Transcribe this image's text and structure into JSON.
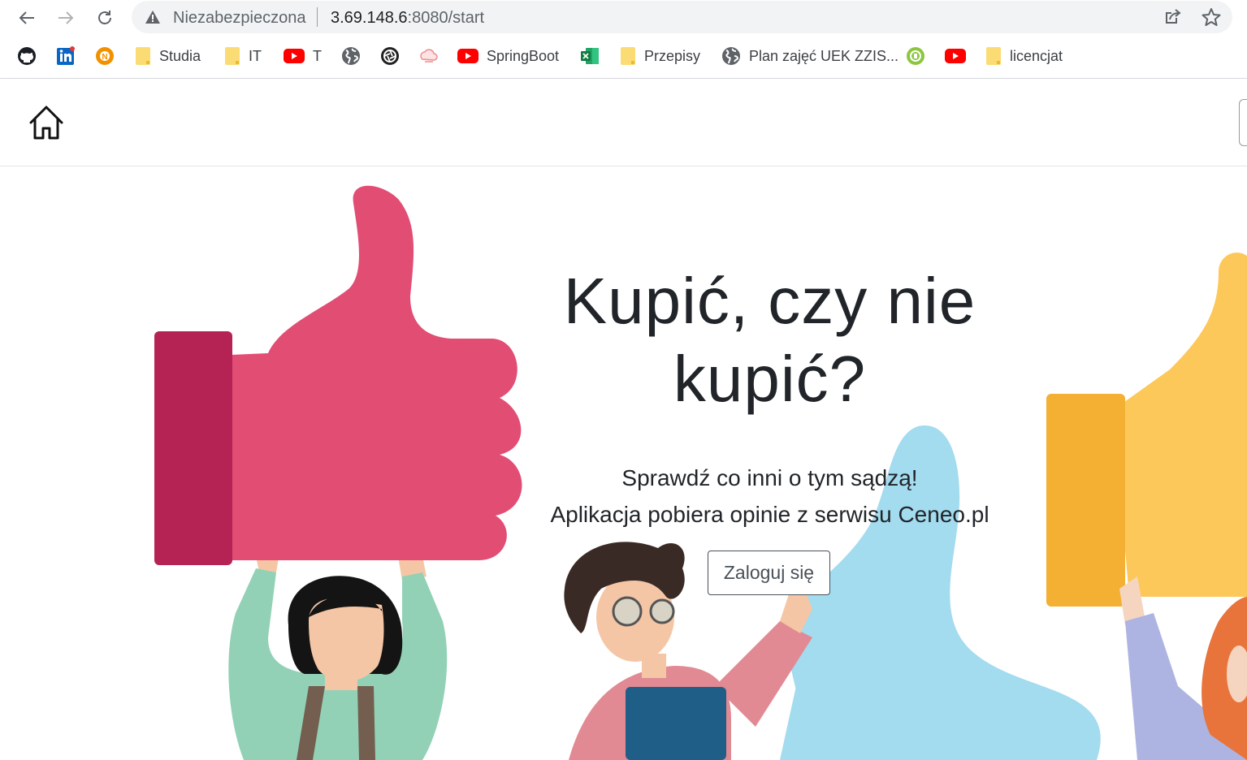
{
  "browser": {
    "security_label": "Niezabezpieczona",
    "url_host": "3.69.148.6",
    "url_rest": ":8080/start",
    "bookmarks": [
      {
        "icon": "github-icon",
        "label": ""
      },
      {
        "icon": "linkedin-icon",
        "label": ""
      },
      {
        "icon": "nn-icon",
        "label": ""
      },
      {
        "icon": "folder-icon",
        "label": "Studia"
      },
      {
        "icon": "folder-icon",
        "label": "IT"
      },
      {
        "icon": "youtube-icon",
        "label": "T"
      },
      {
        "icon": "globe-icon",
        "label": ""
      },
      {
        "icon": "aperture-icon",
        "label": ""
      },
      {
        "icon": "cloud-icon",
        "label": ""
      },
      {
        "icon": "youtube-icon",
        "label": "SpringBoot"
      },
      {
        "icon": "excel-icon",
        "label": ""
      },
      {
        "icon": "folder-icon",
        "label": "Przepisy"
      },
      {
        "icon": "globe-icon",
        "label": "Plan zajęć UEK ZZIS..."
      },
      {
        "icon": "green-badge-icon",
        "label": ""
      },
      {
        "icon": "youtube-icon",
        "label": ""
      },
      {
        "icon": "folder-icon",
        "label": "licencjat"
      }
    ]
  },
  "hero": {
    "title_line1": "Kupić, czy nie",
    "title_line2": "kupić?",
    "subtitle_line1": "Sprawdź co inni o tym sądzą!",
    "subtitle_line2": "Aplikacja pobiera opinie z serwisu Ceneo.pl",
    "login_label": "Zaloguj się"
  },
  "colors": {
    "thumb_pink": "#e24d74",
    "cuff_pink": "#b52355",
    "thumb_yellow": "#fdc85a",
    "cuff_yellow": "#f3b032",
    "thumb_blue": "#a3dbef"
  }
}
